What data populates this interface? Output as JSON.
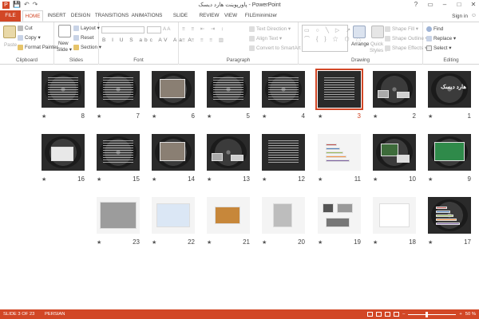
{
  "titlebar": {
    "title": "پاورپوینت هارد دیسک - PowerPoint",
    "app_icon_letter": "P",
    "qat": [
      "💾",
      "↶",
      "↷"
    ]
  },
  "tabs": [
    {
      "label": "FILE"
    },
    {
      "label": "HOME"
    },
    {
      "label": "INSERT"
    },
    {
      "label": "DESIGN"
    },
    {
      "label": "TRANSITIONS"
    },
    {
      "label": "ANIMATIONS"
    },
    {
      "label": "SLIDE SHOW"
    },
    {
      "label": "REVIEW"
    },
    {
      "label": "VIEW"
    },
    {
      "label": "FILEminimizer"
    }
  ],
  "signin": "Sign in",
  "ribbon": {
    "clipboard": {
      "paste": "Paste",
      "cut": "Cut",
      "copy": "Copy",
      "format_painter": "Format Painter",
      "label": "Clipboard"
    },
    "slides": {
      "new_slide": "New",
      "new_slide2": "Slide",
      "layout": "Layout",
      "reset": "Reset",
      "section": "Section",
      "label": "Slides"
    },
    "font": {
      "label": "Font",
      "row2": "B I U S abc AV Aa A"
    },
    "paragraph": {
      "text_direction": "Text Direction",
      "align_text": "Align Text",
      "convert": "Convert to SmartArt",
      "label": "Paragraph"
    },
    "drawing": {
      "arrange": "Arrange",
      "quick_styles": "Quick",
      "quick_styles2": "Styles",
      "shape_fill": "Shape Fill",
      "shape_outline": "Shape Outline",
      "shape_effects": "Shape Effects",
      "label": "Drawing"
    },
    "editing": {
      "find": "Find",
      "replace": "Replace",
      "select": "Select",
      "label": "Editing"
    }
  },
  "slides": [
    {
      "n": "1",
      "style": "disc-title",
      "title": "هارد دیسک"
    },
    {
      "n": "2",
      "style": "disc-pics"
    },
    {
      "n": "3",
      "style": "text",
      "selected": true
    },
    {
      "n": "4",
      "style": "disc-text"
    },
    {
      "n": "5",
      "style": "disc-text"
    },
    {
      "n": "6",
      "style": "disc-photo"
    },
    {
      "n": "7",
      "style": "disc-text"
    },
    {
      "n": "8",
      "style": "disc-text"
    },
    {
      "n": "9",
      "style": "green"
    },
    {
      "n": "10",
      "style": "disc-board"
    },
    {
      "n": "11",
      "style": "bars"
    },
    {
      "n": "12",
      "style": "text"
    },
    {
      "n": "13",
      "style": "disc-pics"
    },
    {
      "n": "14",
      "style": "disc-photo"
    },
    {
      "n": "15",
      "style": "disc-text"
    },
    {
      "n": "16",
      "style": "disc-cable"
    },
    {
      "n": "17",
      "style": "bars-dark"
    },
    {
      "n": "18",
      "style": "white-table"
    },
    {
      "n": "19",
      "style": "white-pics"
    },
    {
      "n": "20",
      "style": "white-box"
    },
    {
      "n": "21",
      "style": "white-board"
    },
    {
      "n": "22",
      "style": "white-screen"
    },
    {
      "n": "23",
      "style": "photo-laptop"
    }
  ],
  "status": {
    "slide_of": "SLIDE 3 OF 23",
    "language": "PERSIAN",
    "zoom": "50 %"
  }
}
